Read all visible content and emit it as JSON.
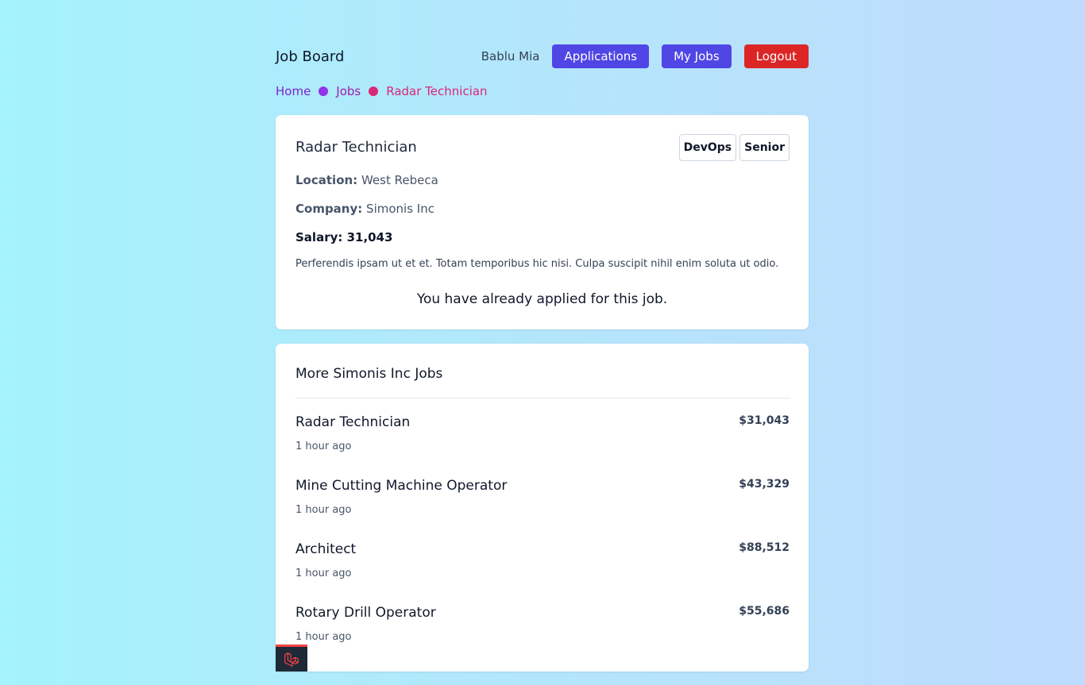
{
  "header": {
    "brand": "Job Board",
    "user_name": "Bablu Mia",
    "applications_label": "Applications",
    "my_jobs_label": "My Jobs",
    "logout_label": "Logout"
  },
  "breadcrumb": [
    "Home",
    "Jobs",
    "Radar Technician"
  ],
  "job": {
    "title": "Radar Technician",
    "tags": [
      "DevOps",
      "Senior"
    ],
    "location_label": "Location:",
    "location": "West Rebeca",
    "company_label": "Company:",
    "company": "Simonis Inc",
    "salary_text": "Salary: 31,043",
    "description": "Perferendis ipsam ut et et. Totam temporibus hic nisi. Culpa suscipit nihil enim soluta ut odio.",
    "applied_message": "You have already applied for this job."
  },
  "more_jobs": {
    "title": "More Simonis Inc Jobs",
    "items": [
      {
        "title": "Radar Technician",
        "time": "1 hour ago",
        "salary": "$31,043"
      },
      {
        "title": "Mine Cutting Machine Operator",
        "time": "1 hour ago",
        "salary": "$43,329"
      },
      {
        "title": "Architect",
        "time": "1 hour ago",
        "salary": "$88,512"
      },
      {
        "title": "Rotary Drill Operator",
        "time": "1 hour ago",
        "salary": "$55,686"
      }
    ]
  },
  "colors": {
    "primary_button": "#4f46e5",
    "logout_button": "#dc2626",
    "breadcrumb_dot_1": "#9333ea",
    "breadcrumb_dot_2": "#db2777"
  },
  "icons": {
    "debug_badge": "laravel-logo-icon"
  }
}
